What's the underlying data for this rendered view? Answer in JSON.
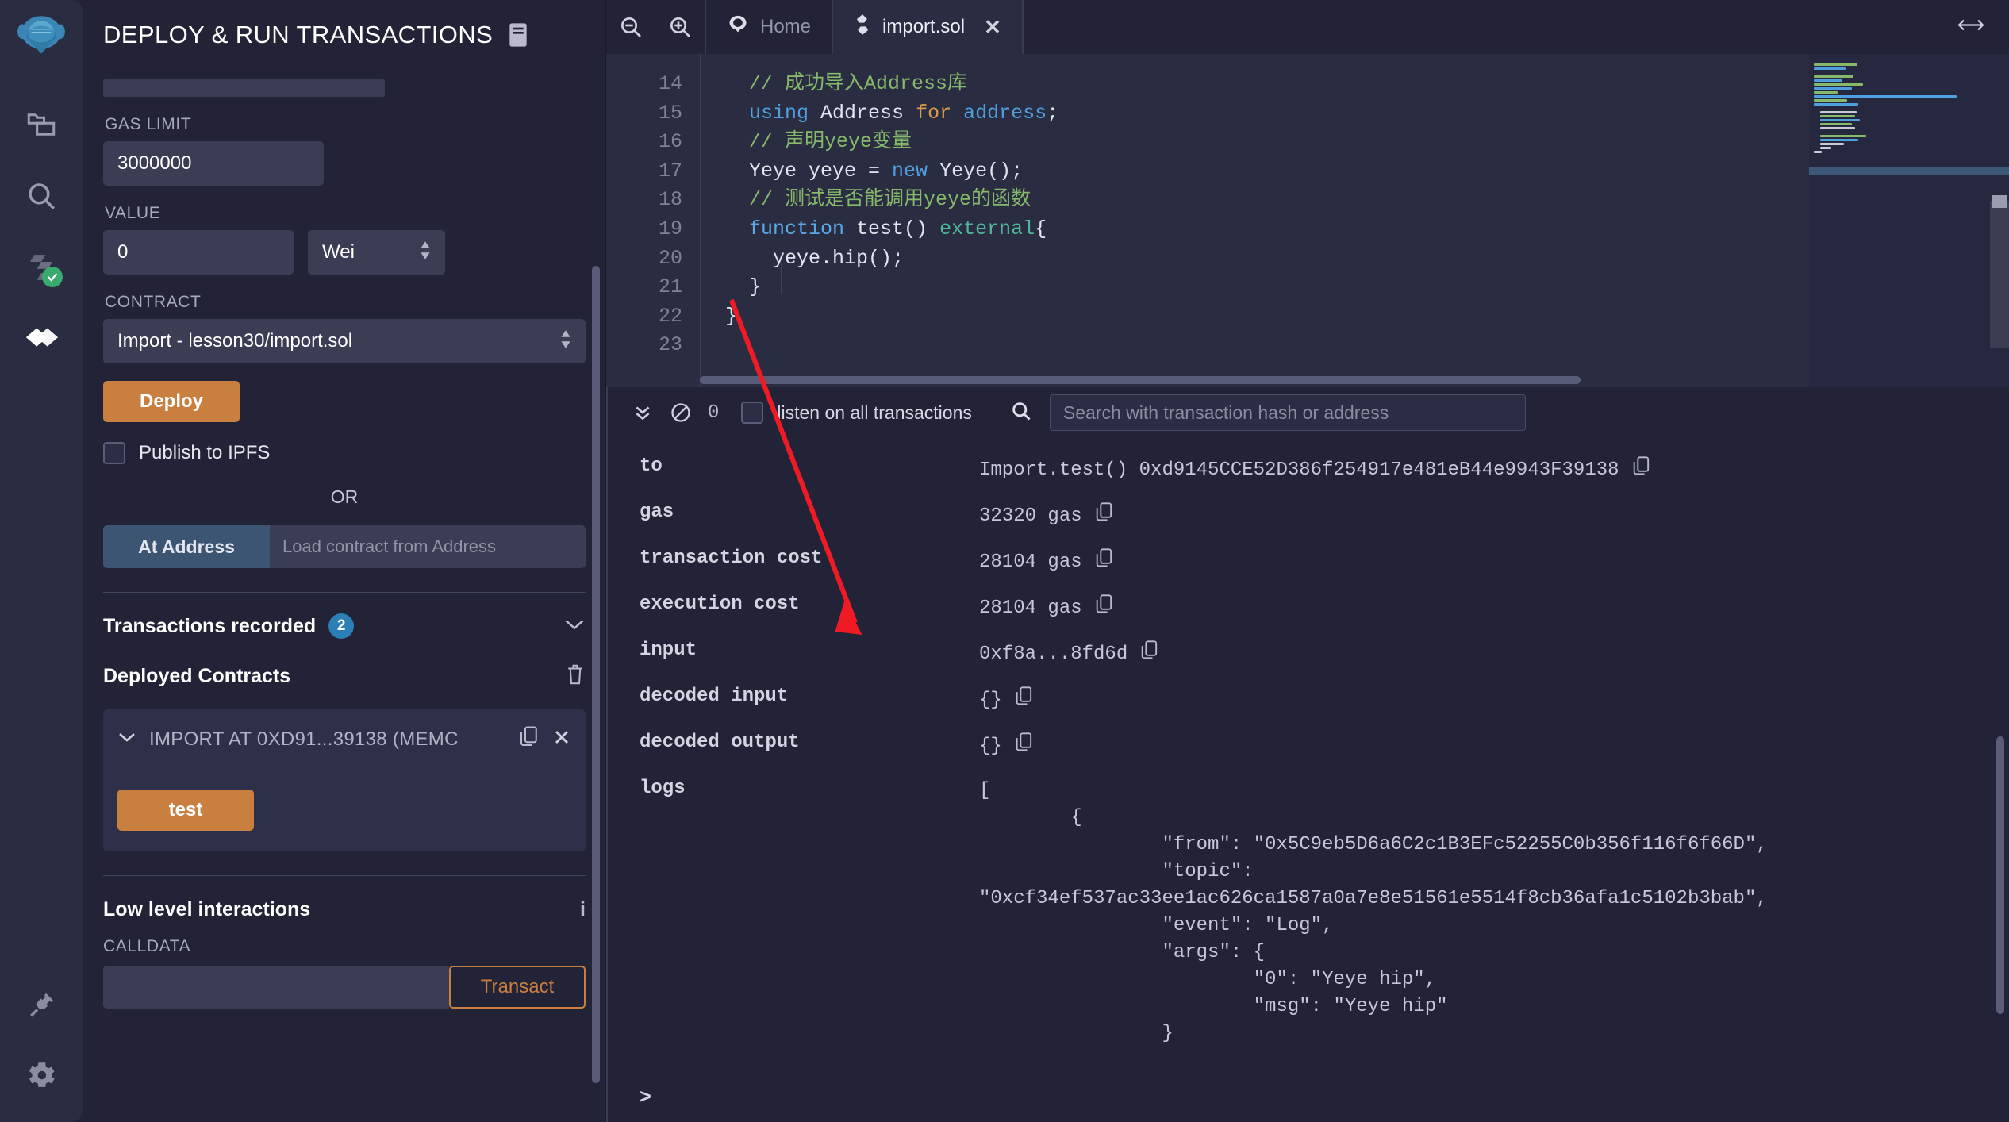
{
  "iconbar": {
    "items": [
      {
        "name": "remix-logo-icon",
        "label": "Remix"
      },
      {
        "name": "file-explorer-icon",
        "label": "File explorers"
      },
      {
        "name": "search-icon",
        "label": "Search in files"
      },
      {
        "name": "solidity-compiler-icon",
        "label": "Solidity compiler"
      },
      {
        "name": "deploy-run-icon",
        "label": "Deploy & run transactions"
      },
      {
        "name": "plugin-manager-icon",
        "label": "Plugin manager"
      },
      {
        "name": "settings-gear-icon",
        "label": "Settings"
      }
    ]
  },
  "panel": {
    "title": "DEPLOY & RUN TRANSACTIONS",
    "gas_limit_label": "GAS LIMIT",
    "gas_limit_value": "3000000",
    "value_label": "VALUE",
    "value_amount": "0",
    "value_unit": "Wei",
    "contract_label": "CONTRACT",
    "contract_value": "Import - lesson30/import.sol",
    "deploy_label": "Deploy",
    "publish_ipfs_label": "Publish to IPFS",
    "or_label": "OR",
    "at_address_label": "At Address",
    "at_address_placeholder": "Load contract from Address",
    "transactions_recorded_label": "Transactions recorded",
    "transactions_recorded_count": "2",
    "deployed_contracts_label": "Deployed Contracts",
    "contract_instance_name": "IMPORT AT 0XD91...39138 (MEMC",
    "test_button_label": "test",
    "low_level_label": "Low level interactions",
    "info_glyph": "i",
    "calldata_label": "CALLDATA",
    "calldata_value": "",
    "transact_label": "Transact"
  },
  "tabs": {
    "home_label": "Home",
    "file_label": "import.sol",
    "close_glyph": "✕"
  },
  "editor": {
    "first_line_number": 14,
    "lines": [
      {
        "num": "14",
        "indent": 2,
        "tokens": [
          {
            "t": "// 成功导入Address库",
            "c": "c-com"
          }
        ]
      },
      {
        "num": "15",
        "indent": 2,
        "tokens": [
          {
            "t": "using",
            "c": "c-kw"
          },
          {
            "t": " Address ",
            "c": "c-type"
          },
          {
            "t": "for",
            "c": "c-kw2"
          },
          {
            "t": " address",
            "c": "c-kw"
          },
          {
            "t": ";",
            "c": "c-type"
          }
        ]
      },
      {
        "num": "16",
        "indent": 2,
        "tokens": [
          {
            "t": "// 声明yeye变量",
            "c": "c-com"
          }
        ]
      },
      {
        "num": "17",
        "indent": 2,
        "tokens": [
          {
            "t": "Yeye yeye = ",
            "c": "c-type"
          },
          {
            "t": "new",
            "c": "c-kw"
          },
          {
            "t": " Yeye();",
            "c": "c-type"
          }
        ]
      },
      {
        "num": "18",
        "indent": 0,
        "tokens": []
      },
      {
        "num": "19",
        "indent": 2,
        "tokens": [
          {
            "t": "// 测试是否能调用yeye的函数",
            "c": "c-com"
          }
        ]
      },
      {
        "num": "20",
        "indent": 2,
        "tokens": [
          {
            "t": "function",
            "c": "c-fn"
          },
          {
            "t": " test() ",
            "c": "c-type"
          },
          {
            "t": "external",
            "c": "c-ext"
          },
          {
            "t": "{",
            "c": "c-type"
          }
        ]
      },
      {
        "num": "21",
        "indent": 4,
        "tokens": [
          {
            "t": "yeye.hip();",
            "c": "c-type"
          }
        ]
      },
      {
        "num": "22",
        "indent": 2,
        "tokens": [
          {
            "t": "}",
            "c": "c-type"
          }
        ]
      },
      {
        "num": "23",
        "indent": 0,
        "tokens": [
          {
            "t": "}",
            "c": "c-type"
          }
        ]
      }
    ]
  },
  "terminal": {
    "pending_count": "0",
    "listen_label": "listen on all transactions",
    "search_placeholder": "Search with transaction hash or address",
    "prompt": ">",
    "rows": [
      {
        "key": "to",
        "value": "Import.test() 0xd9145CCE52D386f254917e481eB44e9943F39138",
        "copy": true
      },
      {
        "key": "gas",
        "value": "32320 gas",
        "copy": true
      },
      {
        "key": "transaction cost",
        "value": "28104 gas",
        "copy": true
      },
      {
        "key": "execution cost",
        "value": "28104 gas",
        "copy": true
      },
      {
        "key": "input",
        "value": "0xf8a...8fd6d",
        "copy": true
      },
      {
        "key": "decoded input",
        "value": "{}",
        "copy": true
      },
      {
        "key": "decoded output",
        "value": "{}",
        "copy": true
      }
    ],
    "logs_key": "logs",
    "logs_text": "[\n\t{\n\t\t\"from\": \"0x5C9eb5D6a6C2c1B3EFc52255C0b356f116f6f66D\",\n\t\t\"topic\":\n\"0xcf34ef537ac33ee1ac626ca1587a0a7e8e51561e5514f8cb36afa1c5102b3bab\",\n\t\t\"event\": \"Log\",\n\t\t\"args\": {\n\t\t\t\"0\": \"Yeye hip\",\n\t\t\t\"msg\": \"Yeye hip\"\n\t\t}"
  },
  "annotation": {
    "arrow_color": "#ee1b24",
    "arrow_name": "red-arrow-annotation"
  },
  "colors": {
    "accent_orange": "#c87f40",
    "accent_blue": "#2b7fb5",
    "panel_bg": "#222336",
    "iconbar_bg": "#2a2c42"
  }
}
